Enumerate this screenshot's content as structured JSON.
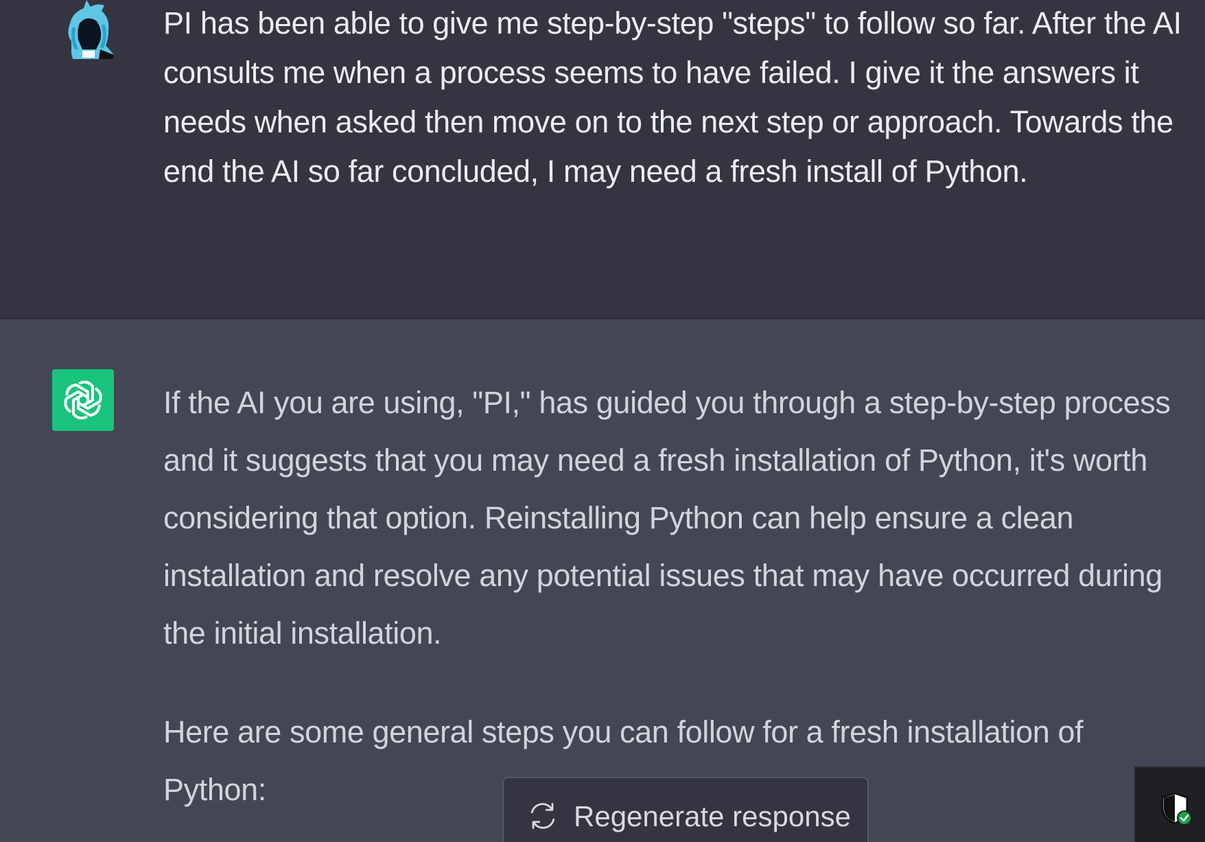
{
  "conversation": {
    "user_message": {
      "avatar_icon": "anime-character-avatar-icon",
      "text": "PI has been able to give me step-by-step \"steps\" to follow so far. After the AI consults me when a process seems to have failed. I give it the answers it needs when asked then move on to the next step or approach. Towards the end the AI so far concluded, I may need a fresh install of Python."
    },
    "assistant_message": {
      "avatar_icon": "openai-logo-icon",
      "avatar_color": "#19c37d",
      "paragraphs": [
        "If the AI you are using, \"PI,\" has guided you through a step-by-step process and it suggests that you may need a fresh installation of Python, it's worth considering that option. Reinstalling Python can help ensure a clean installation and resolve any potential issues that may have occurred during the initial installation.",
        "Here are some general steps you can follow for a fresh installation of Python:"
      ]
    }
  },
  "regenerate": {
    "label": "Regenerate response",
    "icon": "refresh-icon"
  },
  "system_tray": {
    "icon": "security-shield-icon",
    "status_color": "#16a34a"
  },
  "colors": {
    "user_bg": "#343541",
    "assistant_bg": "#444654",
    "text": "#ececf1"
  }
}
